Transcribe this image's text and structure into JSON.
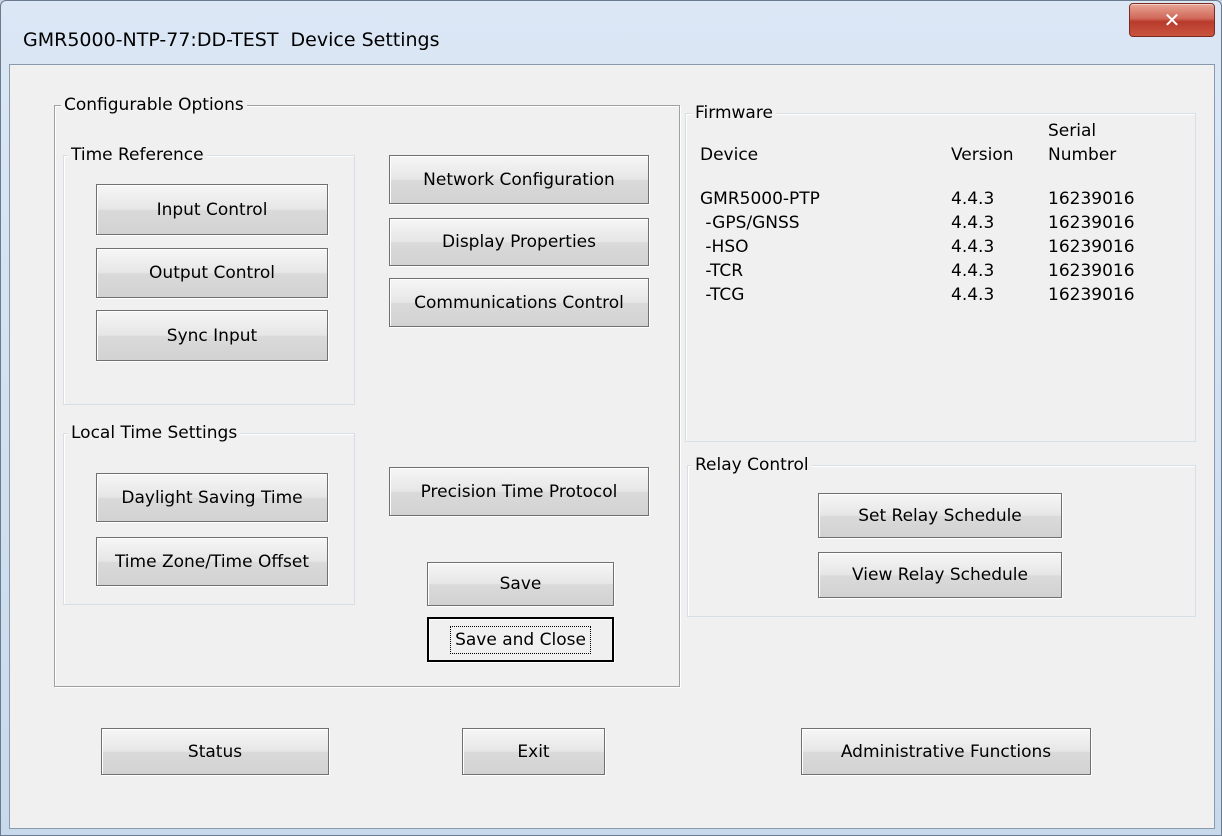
{
  "window": {
    "title": "GMR5000-NTP-77:DD-TEST  Device Settings",
    "close_icon": "✕"
  },
  "configurable": {
    "label": "Configurable Options",
    "time_reference": {
      "label": "Time Reference",
      "input_control": "Input Control",
      "output_control": "Output Control",
      "sync_input": "Sync Input"
    },
    "local_time": {
      "label": "Local Time Settings",
      "dst": "Daylight Saving Time",
      "tz": "Time Zone/Time Offset"
    },
    "network_configuration": "Network Configuration",
    "display_properties": "Display Properties",
    "communications_control": "Communications Control",
    "ptp": "Precision Time Protocol",
    "save": "Save",
    "save_and_close": "Save and Close"
  },
  "firmware": {
    "label": "Firmware",
    "columns": {
      "device": "Device",
      "version": "Version",
      "serial_line1": "Serial",
      "serial_line2": "Number"
    },
    "rows": [
      {
        "device": "GMR5000-PTP",
        "version": "4.4.3",
        "serial": "16239016"
      },
      {
        "device": " -GPS/GNSS",
        "version": "4.4.3",
        "serial": "16239016"
      },
      {
        "device": " -HSO",
        "version": "4.4.3",
        "serial": "16239016"
      },
      {
        "device": " -TCR",
        "version": "4.4.3",
        "serial": "16239016"
      },
      {
        "device": " -TCG",
        "version": "4.4.3",
        "serial": "16239016"
      }
    ]
  },
  "relay": {
    "label": "Relay Control",
    "set_schedule": "Set Relay Schedule",
    "view_schedule": "View Relay Schedule"
  },
  "bottom": {
    "status": "Status",
    "exit": "Exit",
    "admin": "Administrative Functions"
  }
}
